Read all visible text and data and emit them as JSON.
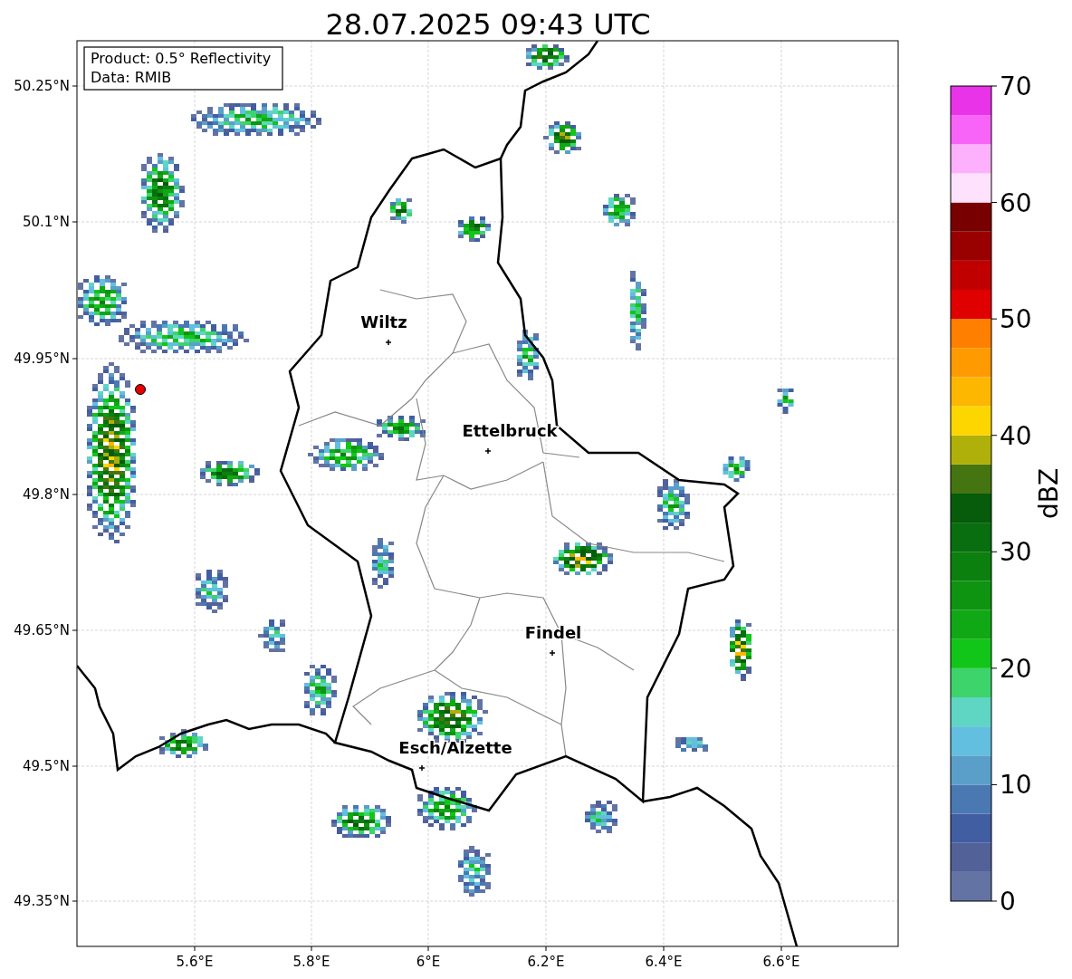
{
  "title": "28.07.2025 09:43 UTC",
  "info_box": [
    "Product: 0.5° Reflectivity",
    "Data: RMIB"
  ],
  "x_axis": {
    "ticks": [
      "5.6°E",
      "5.8°E",
      "6°E",
      "6.2°E",
      "6.4°E",
      "6.6°E"
    ]
  },
  "y_axis": {
    "ticks": [
      "50.25°N",
      "50.1°N",
      "49.95°N",
      "49.8°N",
      "49.65°N",
      "49.5°N",
      "49.35°N"
    ]
  },
  "cities": [
    {
      "name": "Wiltz"
    },
    {
      "name": "Ettelbruck"
    },
    {
      "name": "Findel"
    },
    {
      "name": "Esch/Alzette"
    }
  ],
  "colorbar": {
    "label": "dBZ",
    "ticks": [
      "70",
      "60",
      "50",
      "40",
      "30",
      "20",
      "10",
      "0"
    ],
    "bins": [
      {
        "color": "#6373a3"
      },
      {
        "color": "#536199"
      },
      {
        "color": "#425ea3"
      },
      {
        "color": "#4a78b3"
      },
      {
        "color": "#5a9fc9"
      },
      {
        "color": "#62bfe0"
      },
      {
        "color": "#5fd6c3"
      },
      {
        "color": "#3cd46b"
      },
      {
        "color": "#12c519"
      },
      {
        "color": "#10a814"
      },
      {
        "color": "#0e9410"
      },
      {
        "color": "#0b800f"
      },
      {
        "color": "#096e0f"
      },
      {
        "color": "#065c0a"
      },
      {
        "color": "#457510"
      },
      {
        "color": "#b0b00a"
      },
      {
        "color": "#fdd600"
      },
      {
        "color": "#fdb700"
      },
      {
        "color": "#ff9a00"
      },
      {
        "color": "#ff7f00"
      },
      {
        "color": "#e00000"
      },
      {
        "color": "#c00000"
      },
      {
        "color": "#990000"
      },
      {
        "color": "#780000"
      },
      {
        "color": "#fde1fd"
      },
      {
        "color": "#fdb0fb"
      },
      {
        "color": "#f764f7"
      },
      {
        "color": "#e833e8"
      }
    ]
  }
}
